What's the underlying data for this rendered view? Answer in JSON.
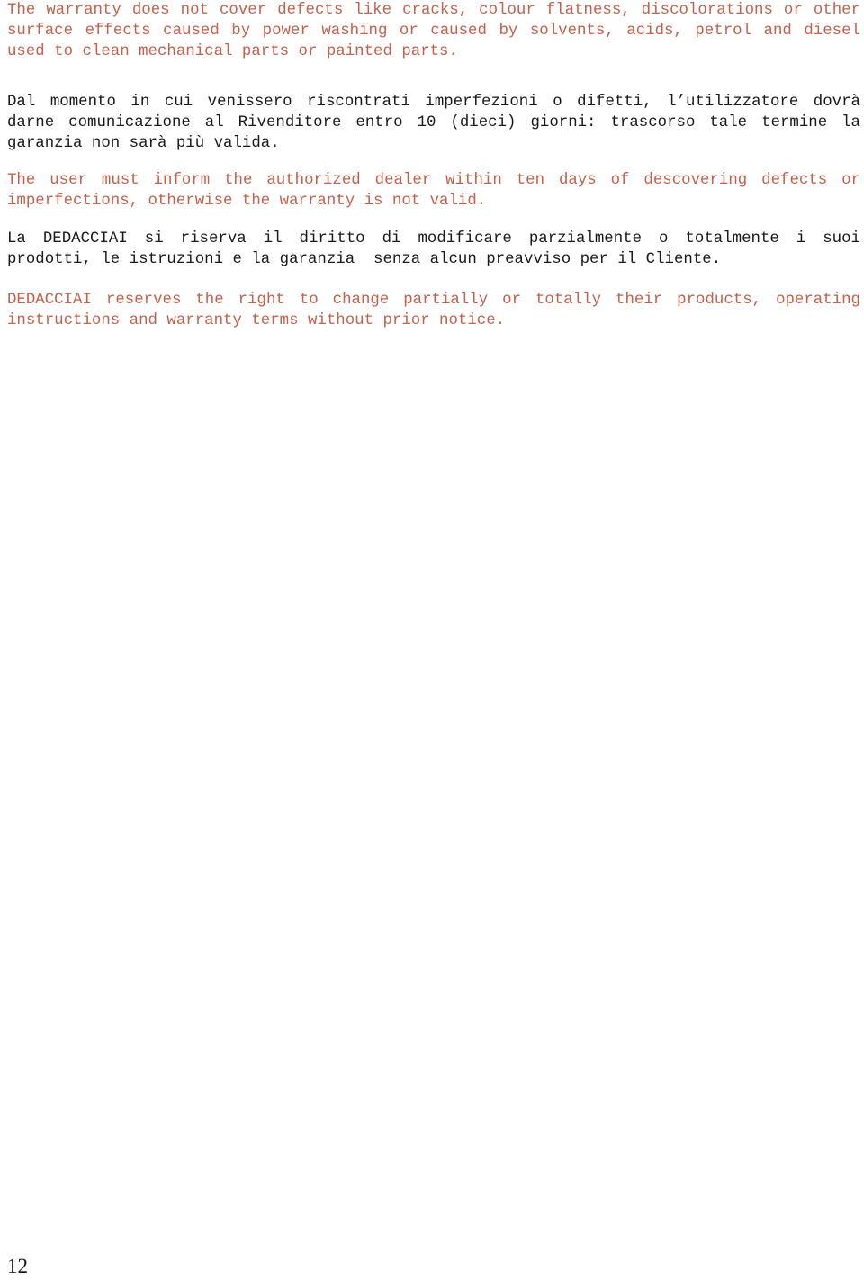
{
  "document": {
    "page_number": "12",
    "colors": {
      "english_text": "#c2614c",
      "italian_text": "#1a1a1a",
      "background": "#ffffff"
    },
    "paragraphs": [
      {
        "id": "warranty-exclusions-en",
        "language": "en",
        "text": "The warranty does not cover defects like cracks, colour flatness, discolorations or other surface effects caused by power washing or caused by solvents, acids, petrol and diesel used to clean mechanical parts or painted parts."
      },
      {
        "id": "defect-notification-it",
        "language": "it",
        "text": "Dal momento in cui venissero riscontrati imperfezioni o difetti, l’utilizzatore dovrà darne comunicazione al Rivenditore entro 10 (dieci) giorni: trascorso tale termine la garanzia non sarà più valida."
      },
      {
        "id": "defect-notification-en",
        "language": "en",
        "text": "The user must inform the authorized dealer within ten days of descovering defects or imperfections, otherwise the warranty is not valid."
      },
      {
        "id": "right-to-change-it",
        "language": "it",
        "text": "La DEDACCIAI si riserva il diritto di modificare parzialmente o totalmente i suoi prodotti, le istruzioni e la garanzia  senza alcun preavviso per il Cliente."
      },
      {
        "id": "right-to-change-en",
        "language": "en",
        "text": "DEDACCIAI reserves the right to change partially or totally their products, operating instructions and warranty terms without prior notice."
      }
    ]
  }
}
